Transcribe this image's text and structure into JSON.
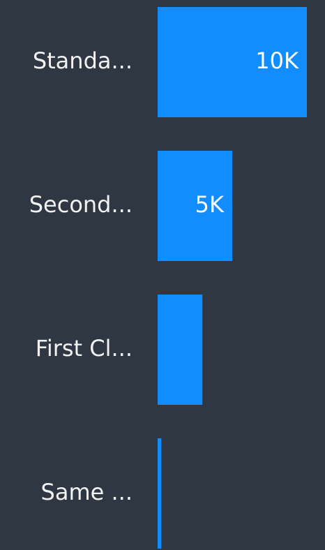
{
  "chart_data": {
    "type": "bar",
    "orientation": "horizontal",
    "categories": [
      "Standa...",
      "Second...",
      "First Cl...",
      "Same ..."
    ],
    "values": [
      10000,
      5000,
      3000,
      250
    ],
    "data_labels": [
      "10K",
      "5K",
      "",
      ""
    ],
    "xlim": [
      0,
      10000
    ],
    "grid": false,
    "legend": "none",
    "colors": {
      "background": "#2f3742",
      "bar": "#118dff",
      "text": "#f2f2f2",
      "data_label": "#ffffff"
    }
  }
}
